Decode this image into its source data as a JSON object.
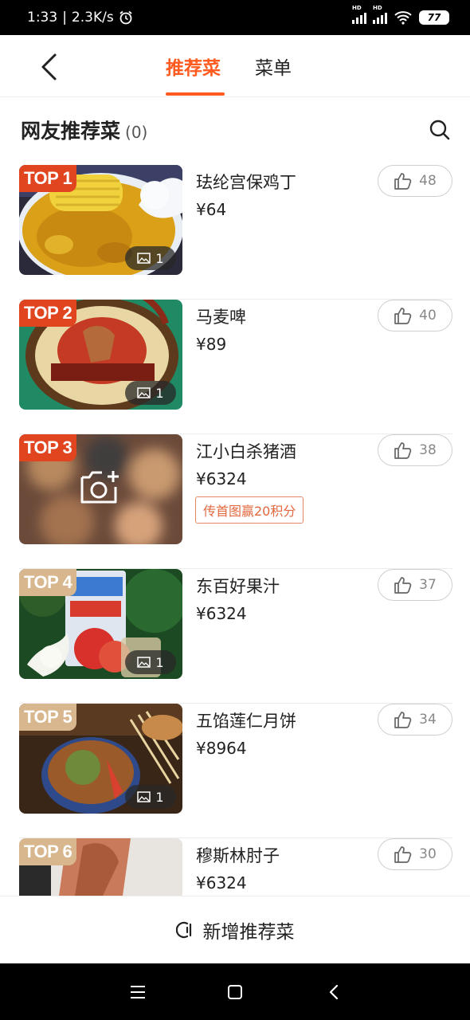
{
  "status_bar": {
    "time": "1:33",
    "speed": "2.3K/s",
    "battery": "77"
  },
  "header": {
    "tabs": [
      "推荐菜",
      "菜单"
    ],
    "active_tab": 0
  },
  "section": {
    "title": "网友推荐菜",
    "count": "(0)"
  },
  "dishes": [
    {
      "rank": "TOP 1",
      "name": "珐纶宫保鸡丁",
      "price": "¥64",
      "likes": "48",
      "images": "1"
    },
    {
      "rank": "TOP 2",
      "name": "马麦啤",
      "price": "¥89",
      "likes": "40",
      "images": "1"
    },
    {
      "rank": "TOP 3",
      "name": "江小白杀猪酒",
      "price": "¥6324",
      "likes": "38",
      "points_tag": "传首图赢20积分"
    },
    {
      "rank": "TOP 4",
      "name": "东百好果汁",
      "price": "¥6324",
      "likes": "37",
      "images": "1"
    },
    {
      "rank": "TOP 5",
      "name": "五馅莲仁月饼",
      "price": "¥8964",
      "likes": "34",
      "images": "1"
    },
    {
      "rank": "TOP 6",
      "name": "穆斯林肘子",
      "price": "¥6324",
      "likes": "30"
    }
  ],
  "bottom_action": {
    "label": "新增推荐菜"
  },
  "colors": {
    "accent": "#ff5a1f",
    "badge_top3": "#e0451f",
    "badge_rest": "#d8b68e"
  }
}
